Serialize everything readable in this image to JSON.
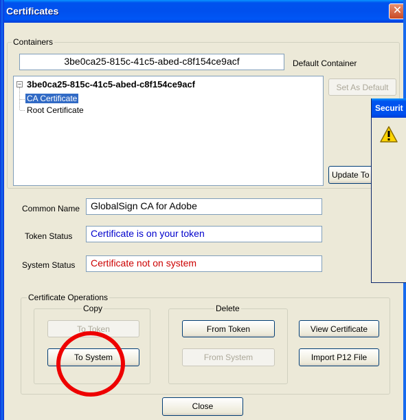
{
  "window": {
    "title": "Certificates",
    "close_glyph": "✕"
  },
  "containers": {
    "legend": "Containers",
    "selected_container": "3be0ca25-815c-41c5-abed-c8f154ce9acf",
    "default_label": "Default Container",
    "tree": {
      "expander": "−",
      "root": "3be0ca25-815c-41c5-abed-c8f154ce9acf",
      "children": [
        "CA Certificate",
        "Root Certificate"
      ]
    },
    "set_default_button": "Set As Default",
    "update_button": "Update To"
  },
  "details": {
    "common_name_label": "Common Name",
    "common_name_value": "GlobalSign CA for Adobe",
    "token_status_label": "Token Status",
    "token_status_value": "Certificate is on your token",
    "system_status_label": "System Status",
    "system_status_value": "Certificate not on system"
  },
  "operations": {
    "legend": "Certificate Operations",
    "copy": {
      "legend": "Copy",
      "to_token": "To Token",
      "to_system": "To System"
    },
    "delete": {
      "legend": "Delete",
      "from_token": "From Token",
      "from_system": "From System"
    },
    "view_certificate": "View Certificate",
    "import_p12": "Import P12 File"
  },
  "close_button": "Close",
  "security_dialog": {
    "title": "Securit",
    "icon": "warning-icon"
  },
  "colors": {
    "title_blue": "#0053ee",
    "selection": "#316ac5",
    "token_status_text": "#0000cc",
    "system_status_text": "#cc0000",
    "annotation_circle": "#ee0000"
  }
}
